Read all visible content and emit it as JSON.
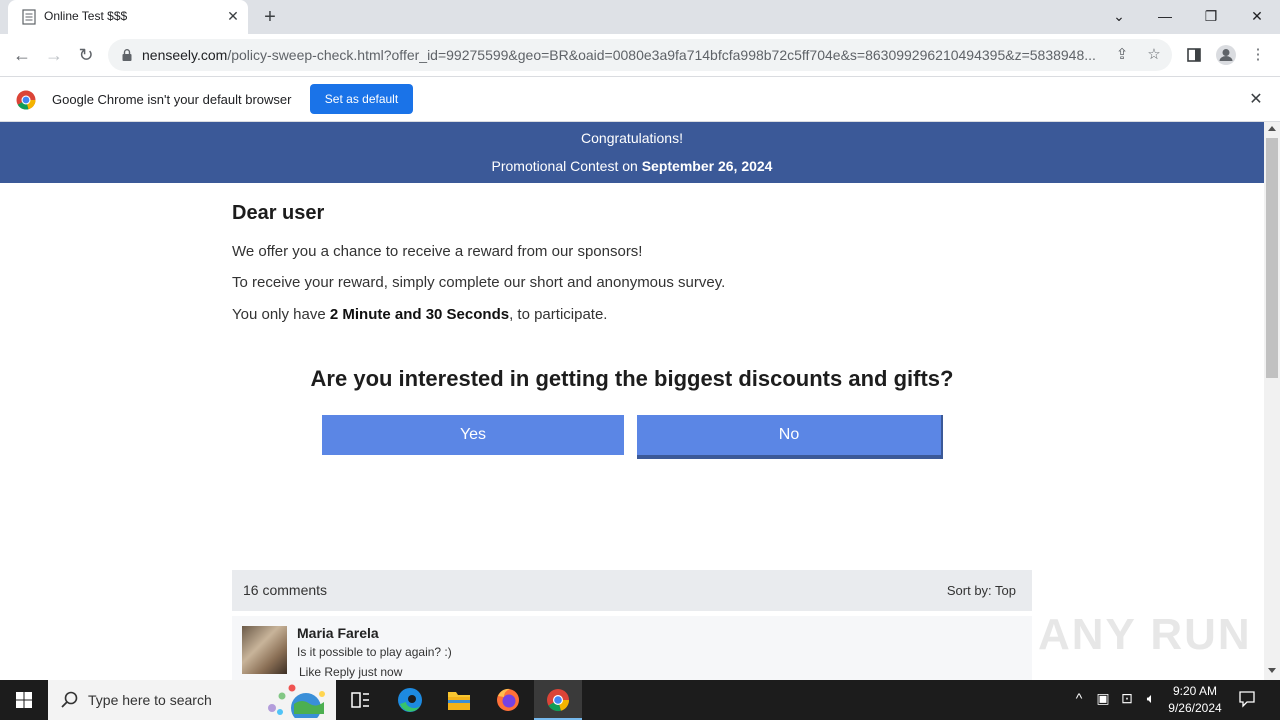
{
  "browser": {
    "tab_title": "Online Test $$$",
    "url_host": "nenseely.com",
    "url_path": "/policy-sweep-check.html?offer_id=99275599&geo=BR&oaid=0080e3a9fa714bfcfa998b72c5ff704e&s=863099296210494395&z=5838948...",
    "infobar_text": "Google Chrome isn't your default browser",
    "infobar_button": "Set as default"
  },
  "banner": {
    "line1": "Congratulations!",
    "line2_prefix": "Promotional Contest on ",
    "line2_date": "September 26, 2024"
  },
  "content": {
    "heading": "Dear user",
    "p1": "We offer you a chance to receive a reward from our sponsors!",
    "p2": "To receive your reward, simply complete our short and anonymous survey.",
    "p3_prefix": "You only have ",
    "p3_bold": "2 Minute and 30 Seconds",
    "p3_suffix": ", to participate.",
    "question": "Are you interested in getting the biggest discounts and gifts?",
    "yes_label": "Yes",
    "no_label": "No"
  },
  "comments": {
    "count_label": "16 comments",
    "sort_label": "Sort by:  Top",
    "items": [
      {
        "name": "Maria Farela",
        "text": "Is it possible to play again? :)",
        "actions": "Like Reply  just now"
      }
    ]
  },
  "watermark": "ANY RUN",
  "taskbar": {
    "search_placeholder": "Type here to search",
    "time": "9:20 AM",
    "date": "9/26/2024"
  },
  "colors": {
    "banner": "#3b5998",
    "button": "#5b86e5",
    "chrome_blue": "#1a73e8"
  }
}
